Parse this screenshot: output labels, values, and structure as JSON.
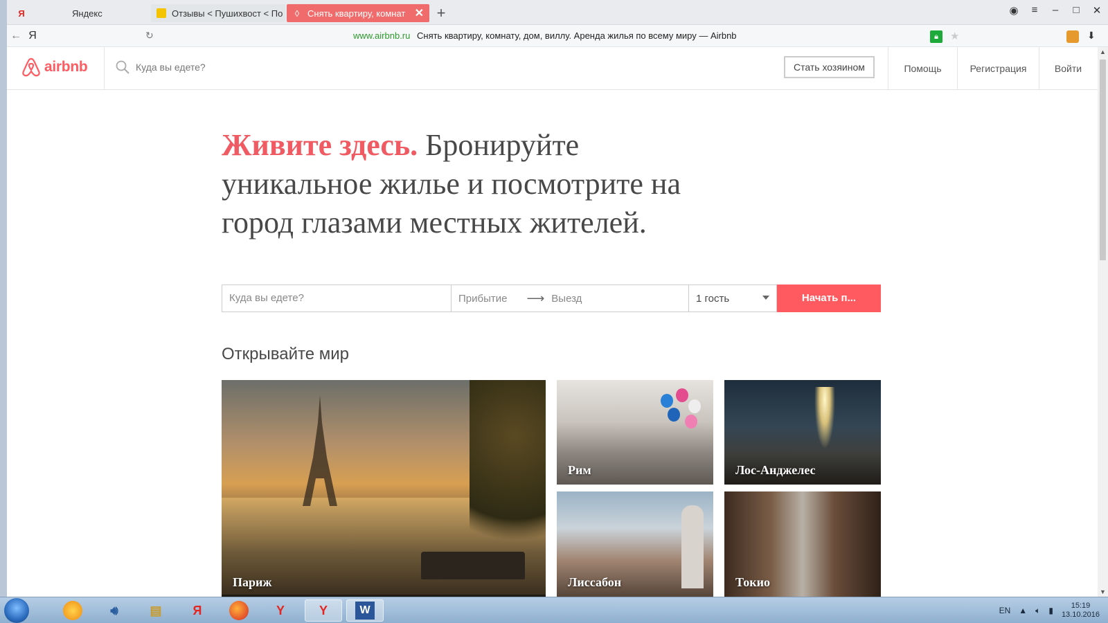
{
  "browser": {
    "tabs": [
      {
        "label": "Яндекс",
        "favicon": "yandex-icon"
      },
      {
        "label": "Отзывы < Пушихвост < По",
        "favicon": "folder-icon"
      },
      {
        "label": "Снять квартиру, комнат",
        "favicon": "airbnb-icon"
      }
    ],
    "address": {
      "domain": "www.airbnb.ru",
      "title": "Снять квартиру, комнату, дом, виллу. Аренда жилья по всему миру — Airbnb"
    }
  },
  "header": {
    "logo_text": "airbnb",
    "search_placeholder": "Куда вы едете?",
    "host_button": "Стать хозяином",
    "help": "Помощь",
    "register": "Регистрация",
    "login": "Войти"
  },
  "hero": {
    "accent": "Живите здесь.",
    "text": "Бронируйте уникальное жилье и посмотрите на город глазами местных жителей."
  },
  "search": {
    "where_placeholder": "Куда вы едете?",
    "checkin": "Прибытие",
    "checkout": "Выезд",
    "guests": "1 гость",
    "submit": "Начать п..."
  },
  "explore": {
    "title": "Открывайте мир",
    "cities": [
      "Париж",
      "Рим",
      "Лос-Анджелес",
      "Лиссабон",
      "Токио"
    ]
  },
  "taskbar": {
    "lang": "EN",
    "time": "15:19",
    "date": "13.10.2016"
  },
  "colors": {
    "brand": "#ff5a5f",
    "accent_text": "#f05b63",
    "active_tab": "#f06c6c"
  }
}
